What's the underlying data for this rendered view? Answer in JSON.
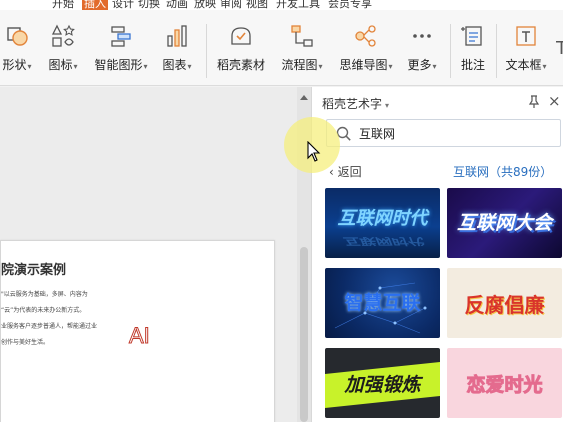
{
  "tabs": [
    "开始",
    "插入",
    "设计",
    "切换",
    "动画",
    "放映",
    "审阅",
    "视图",
    "开发工具",
    "会员专享"
  ],
  "tabs_active": "插入",
  "ribbon": {
    "buttons": [
      {
        "label": "形状",
        "icon": "shapes-icon",
        "dropdown": true
      },
      {
        "label": "图标",
        "icon": "icons-icon",
        "dropdown": true
      },
      {
        "label": "智能图形",
        "icon": "smart-graphic-icon",
        "dropdown": true
      },
      {
        "label": "图表",
        "icon": "chart-icon",
        "dropdown": true
      },
      {
        "label": "稻壳素材",
        "icon": "docer-material-icon",
        "dropdown": false
      },
      {
        "label": "流程图",
        "icon": "flowchart-icon",
        "dropdown": true
      },
      {
        "label": "思维导图",
        "icon": "mindmap-icon",
        "dropdown": true
      },
      {
        "label": "更多",
        "icon": "more-icon",
        "dropdown": true
      },
      {
        "label": "批注",
        "icon": "comment-icon",
        "dropdown": false
      },
      {
        "label": "文本框",
        "icon": "textbox-icon",
        "dropdown": true
      }
    ],
    "right_stub": "T"
  },
  "slide": {
    "title": "院演示案例",
    "lines": [
      "\"以云服务为基础，多屏、内容为",
      "“云”为代表的未来办公新方式。",
      "业服务客户逐步普通人，帮能通过业",
      "创作与美好生活。"
    ],
    "ai_text": "AI"
  },
  "panel": {
    "title": "稻壳艺术字",
    "search_value": "互联网",
    "back_label": "返回",
    "result_count": "互联网（共89份）",
    "thumbnails": [
      {
        "text": "互联网时代",
        "style": "blue-tech"
      },
      {
        "text": "互联网大会",
        "style": "purple-glow"
      },
      {
        "text": "智慧互联",
        "style": "blue-network"
      },
      {
        "text": "反腐倡廉",
        "style": "red-gold"
      },
      {
        "text": "加强锻炼",
        "style": "lime-dark"
      },
      {
        "text": "恋爱时光",
        "style": "pink-soft"
      }
    ]
  },
  "colors": {
    "accent_orange": "#e26b2c",
    "link_blue": "#2a6fbf"
  }
}
